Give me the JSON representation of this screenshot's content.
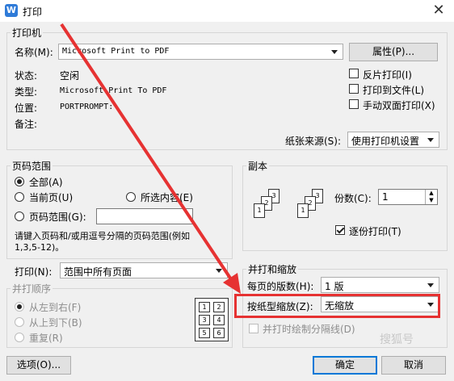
{
  "window": {
    "title": "打印",
    "app_icon_letter": "W"
  },
  "printer": {
    "group_label": "打印机",
    "name_label": "名称(M):",
    "name_value": "Microsoft Print to PDF",
    "properties_button": "属性(P)...",
    "status_label": "状态:",
    "status_value": "空闲",
    "type_label": "类型:",
    "type_value": "Microsoft Print To PDF",
    "location_label": "位置:",
    "location_value": "PORTPROMPT:",
    "comment_label": "备注:",
    "reverse_print": "反片打印(I)",
    "print_to_file": "打印到文件(L)",
    "manual_duplex": "手动双面打印(X)",
    "paper_source_label": "纸张来源(S):",
    "paper_source_value": "使用打印机设置"
  },
  "page_range": {
    "group_label": "页码范围",
    "all": "全部(A)",
    "current": "当前页(U)",
    "selection": "所选内容(E)",
    "pages": "页码范围(G):",
    "pages_value": "",
    "hint_line1": "请键入页码和/或用逗号分隔的页码范围(例如",
    "hint_line2": "1,3,5-12)。"
  },
  "copies": {
    "group_label": "副本",
    "count_label": "份数(C):",
    "count_value": "1",
    "collate": "逐份打印(T)"
  },
  "print_what": {
    "label": "打印(N):",
    "value": "范围中所有页面"
  },
  "order": {
    "group_label": "并打顺序",
    "left_to_right": "从左到右(F)",
    "top_to_bottom": "从上到下(B)",
    "repeat": "重复(R)",
    "preview_pages": [
      "1",
      "2",
      "3",
      "4",
      "5",
      "6"
    ]
  },
  "zoom": {
    "group_label": "并打和缩放",
    "pages_per_sheet_label": "每页的版数(H):",
    "pages_per_sheet_value": "1 版",
    "scale_label": "按纸型缩放(Z):",
    "scale_value": "无缩放",
    "draw_borders": "并打时绘制分隔线(D)"
  },
  "footer": {
    "options_button": "选项(O)...",
    "ok_button": "确定",
    "cancel_button": "取消"
  },
  "copy_icons": {
    "stack1": [
      "1",
      "2",
      "3"
    ],
    "stack2": [
      "1",
      "2",
      "3"
    ]
  },
  "watermark": "搜狐号",
  "colors": {
    "annotation_red": "#e63232",
    "accent": "#0078d7"
  }
}
